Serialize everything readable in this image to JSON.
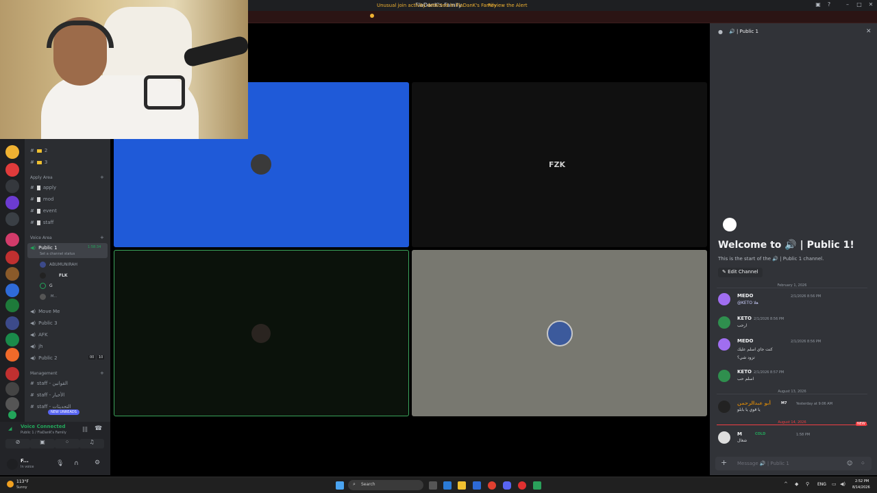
{
  "window": {
    "title": "FlaDanK's Family"
  },
  "alert": {
    "text": "Unusual join activity detected in FlaDanK's Family",
    "link": "Review the Alert"
  },
  "channels": {
    "top_items": [
      "2",
      "3"
    ],
    "categories": [
      {
        "name": "Apply Area",
        "items": [
          "apply",
          "mod",
          "event",
          "staff"
        ]
      },
      {
        "name": "Voice Area"
      },
      {
        "name": "Management",
        "items": [
          "staff - القوانين",
          "staff - الأخبار",
          "staff - التحديثات"
        ]
      }
    ],
    "active_voice": {
      "name": "Public 1",
      "timer": "1:58:34",
      "status": "Set a channel status"
    },
    "voice_members": [
      "ABUMUNIRAH",
      "FLK",
      "G",
      "M..."
    ],
    "voice_channels": [
      {
        "name": "Move Me"
      },
      {
        "name": "Public 3"
      },
      {
        "name": "AFK"
      },
      {
        "name": "jh"
      },
      {
        "name": "Public 2",
        "count_a": "00",
        "count_b": "10"
      }
    ],
    "new_unreads": "NEW UNREADS"
  },
  "voice_panel": {
    "status": "Voice Connected",
    "location": "Public 1 / FlaDanK's Family"
  },
  "user": {
    "name": "F...",
    "status": "In voice"
  },
  "stage": {
    "tile2_label": "FZK"
  },
  "chat": {
    "header": "Public 1",
    "welcome": "Welcome to 🔊 | Public 1!",
    "subtitle": "This is the start of the 🔊 | Public 1 channel.",
    "edit_button": "Edit Channel",
    "date1": "February 1, 2026",
    "messages": [
      {
        "name": "MEDO",
        "tag": "ﷺ",
        "time": "2/1/2026 8:56 PM",
        "text": "@KETO هلا",
        "color": "#a06ef0"
      },
      {
        "name": "KETO",
        "tag": "",
        "time": "2/1/2026 8:56 PM",
        "text": "ارحب",
        "color": "#2f8f4e"
      },
      {
        "name": "MEDO",
        "tag": "ﷺ",
        "time": "2/1/2026 8:56 PM",
        "text": "كنت جاي اسلم عليك\nتزود شي؟",
        "color": "#a06ef0"
      },
      {
        "name": "KETO",
        "tag": "",
        "time": "2/1/2026 8:57 PM",
        "text": "اسلم حب",
        "color": "#2f8f4e"
      }
    ],
    "date2": "August 13, 2026",
    "msg5": {
      "name": "أبو عبدالرحمن",
      "tag": "M7",
      "time": "Yesterday at 9:06 AM",
      "text": "يا قوي يا بابلو"
    },
    "date3": "August 14, 2026",
    "new_badge": "NEW",
    "msg6": {
      "name": "M",
      "tag": "COLD",
      "time": "1:58 PM",
      "text": "شغال"
    },
    "input_placeholder": "Message 🔊 | Public 1"
  },
  "taskbar": {
    "weather_temp": "113°F",
    "weather_desc": "Sunny",
    "search": "Search",
    "lang": "ENG",
    "time": "2:52 PM",
    "date": "8/14/2026"
  },
  "colors": {
    "accent": "#5865f2",
    "online": "#23a55a",
    "blue_tile": "#1f5ad8",
    "gray_tile": "#787870"
  }
}
